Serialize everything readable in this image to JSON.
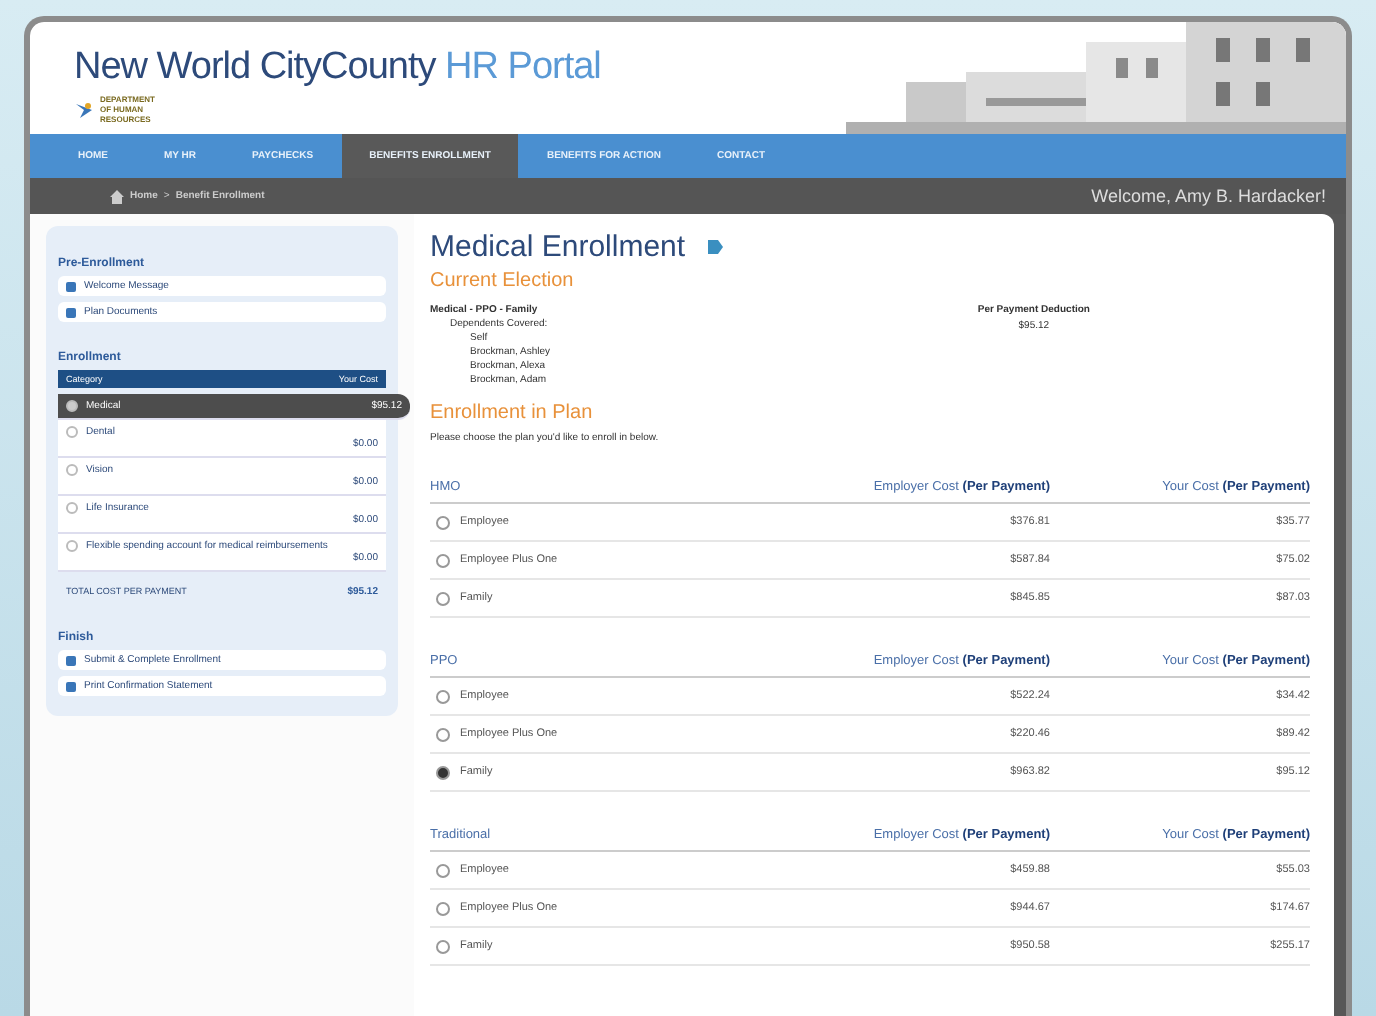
{
  "header": {
    "title_main": "New World CityCounty",
    "title_accent": "HR Portal",
    "logo_text": "DEPARTMENT OF HUMAN RESOURCES"
  },
  "nav": [
    {
      "label": "HOME",
      "selected": false
    },
    {
      "label": "MY HR",
      "selected": false
    },
    {
      "label": "PAYCHECKS",
      "selected": false
    },
    {
      "label": "BENEFITS ENROLLMENT",
      "selected": true
    },
    {
      "label": "BENEFITS FOR ACTION",
      "selected": false
    },
    {
      "label": "CONTACT",
      "selected": false
    }
  ],
  "breadcrumb": {
    "items": [
      "Home",
      "Benefit Enrollment"
    ],
    "separator": ">"
  },
  "welcome": "Welcome, Amy B. Hardacker!",
  "sidebar": {
    "pre_title": "Pre-Enrollment",
    "pre_items": [
      "Welcome Message",
      "Plan Documents"
    ],
    "enroll_title": "Enrollment",
    "columns": [
      "Category",
      "Your Cost"
    ],
    "categories": [
      {
        "name": "Medical",
        "cost": "$95.12",
        "selected": true
      },
      {
        "name": "Dental",
        "cost": "$0.00",
        "selected": false
      },
      {
        "name": "Vision",
        "cost": "$0.00",
        "selected": false
      },
      {
        "name": "Life Insurance",
        "cost": "$0.00",
        "selected": false
      },
      {
        "name": "Flexible spending account for medical reimbursements",
        "cost": "$0.00",
        "selected": false
      }
    ],
    "total_label": "TOTAL COST PER PAYMENT",
    "total": "$95.12",
    "finish_title": "Finish",
    "finish_items": [
      "Submit & Complete Enrollment",
      "Print Confirmation Statement"
    ]
  },
  "main": {
    "title": "Medical Enrollment",
    "current_title": "Current Election",
    "election": "Medical - PPO - Family",
    "dependents_label": "Dependents Covered:",
    "dependents": [
      "Self",
      "Brockman, Ashley",
      "Brockman, Alexa",
      "Brockman, Adam"
    ],
    "deduction_label": "Per Payment Deduction",
    "deduction": "$95.12",
    "enroll_title": "Enrollment in Plan",
    "instruction": "Please choose the plan you'd like to enroll in below.",
    "plans": [
      {
        "name": "HMO",
        "employer_header": "Employer Cost **(Per Payment)**",
        "your_header": "Your Cost **(Per Payment)**",
        "options": [
          {
            "label": "Employee",
            "employer": "$376.81",
            "yours": "$35.77",
            "selected": false
          },
          {
            "label": "Employee Plus One",
            "employer": "$587.84",
            "yours": "$75.02",
            "selected": false
          },
          {
            "label": "Family",
            "employer": "$845.85",
            "yours": "$87.03",
            "selected": false
          }
        ]
      },
      {
        "name": "PPO",
        "employer_header": "Employer Cost **(Per Payment)**",
        "your_header": "Your Cost **(Per Payment)**",
        "options": [
          {
            "label": "Employee",
            "employer": "$522.24",
            "yours": "$34.42",
            "selected": false
          },
          {
            "label": "Employee Plus One",
            "employer": "$220.46",
            "yours": "$89.42",
            "selected": false
          },
          {
            "label": "Family",
            "employer": "$963.82",
            "yours": "$95.12",
            "selected": true
          }
        ]
      },
      {
        "name": "Traditional",
        "employer_header": "Employer Cost **(Per Payment)**",
        "your_header": "Your Cost **(Per Payment)**",
        "options": [
          {
            "label": "Employee",
            "employer": "$459.88",
            "yours": "$55.03",
            "selected": false
          },
          {
            "label": "Employee Plus One",
            "employer": "$944.67",
            "yours": "$174.67",
            "selected": false
          },
          {
            "label": "Family",
            "employer": "$950.58",
            "yours": "$255.17",
            "selected": false
          }
        ]
      }
    ]
  }
}
